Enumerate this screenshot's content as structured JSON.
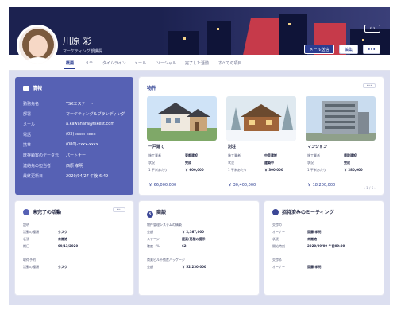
{
  "header": {
    "name": "川原 彩",
    "role": "マーケティング部課長",
    "nav_arrows": "‹  ›",
    "email_button": "メール送信",
    "edit_button": "編集",
    "more_button": "•••"
  },
  "tabs": [
    {
      "label": "概要",
      "active": true
    },
    {
      "label": "メモ",
      "active": false
    },
    {
      "label": "タイムライン",
      "active": false
    },
    {
      "label": "メール",
      "active": false
    },
    {
      "label": "ソーシャル",
      "active": false
    },
    {
      "label": "完了した活動",
      "active": false
    },
    {
      "label": "すべての項目",
      "active": false
    }
  ],
  "info": {
    "title": "情報",
    "rows": [
      {
        "key": "勤務先名",
        "value": "TSKエステート"
      },
      {
        "key": "部署",
        "value": "マーケティング＆ブランディング"
      },
      {
        "key": "メール",
        "value": "a.kawahara@tskest.com"
      },
      {
        "key": "電話",
        "value": "(03)-xxxx-xxxx"
      },
      {
        "key": "携帯",
        "value": "(080)-xxxx-xxxx"
      },
      {
        "key": "既存顧客のデータ元",
        "value": "パートナー"
      },
      {
        "key": "連絡先の担当者",
        "value": "西原 孝明"
      },
      {
        "key": "最終更新日",
        "value": "2020/04/27 午後 6:49"
      }
    ]
  },
  "properties": {
    "title": "物件",
    "more": "•••",
    "pager": "‹ 1 / 6 ›",
    "items": [
      {
        "name": "一戸建て",
        "rows": [
          {
            "l": "施工業者",
            "r": "東都建設"
          },
          {
            "l": "状況",
            "r": "完成"
          },
          {
            "l": "1 平米あたり",
            "r": "￥ 600,000"
          }
        ],
        "price": "￥ 66,000,000"
      },
      {
        "name": "別荘",
        "rows": [
          {
            "l": "施工業者",
            "r": "中見建設"
          },
          {
            "l": "状況",
            "r": "建築中"
          },
          {
            "l": "1 平米あたり",
            "r": "￥ 300,000"
          }
        ],
        "price": "￥ 30,400,000"
      },
      {
        "name": "マンション",
        "rows": [
          {
            "l": "施工業者",
            "r": "鹿取建設"
          },
          {
            "l": "状況",
            "r": "完成"
          },
          {
            "l": "1 平米あたり",
            "r": "￥ 280,000"
          }
        ],
        "price": "￥ 18,200,000"
      }
    ]
  },
  "activities": {
    "title": "未完了の活動",
    "more": "•••",
    "group1": "説明",
    "rows1": [
      {
        "k": "活動の種類",
        "v": "タスク"
      },
      {
        "k": "状況",
        "v": "未開始"
      },
      {
        "k": "期日",
        "v": "09/13/2020"
      }
    ],
    "group2": "取得予約",
    "rows2": [
      {
        "k": "活動の種類",
        "v": "タスク"
      }
    ]
  },
  "deals": {
    "title": "商談",
    "badge": "5",
    "group1": "物件管理システムの構築",
    "rows1": [
      {
        "k": "金額",
        "v": "￥ 2,167,000"
      },
      {
        "k": "ステージ",
        "v": "提案/見積の提示"
      },
      {
        "k": "確度（%）",
        "v": "62"
      }
    ],
    "group2": "商業ビル不動産パッケージ",
    "rows2": [
      {
        "k": "金額",
        "v": "￥ 52,230,000"
      }
    ]
  },
  "meetings": {
    "title": "招待済みのミーティング",
    "group1": "交渉の",
    "rows1": [
      {
        "k": "オーナー",
        "v": "斎藤 孝明"
      },
      {
        "k": "状況",
        "v": "未開始"
      },
      {
        "k": "開始時刻",
        "v": "2020/09/09 午前09:00"
      }
    ],
    "group2": "交渉る",
    "rows2": [
      {
        "k": "オーナー",
        "v": "斎藤 孝明"
      }
    ]
  },
  "colors": {
    "accent": "#2b3d91",
    "info_card": "#5661b4",
    "header_bg": "#1c2250"
  }
}
